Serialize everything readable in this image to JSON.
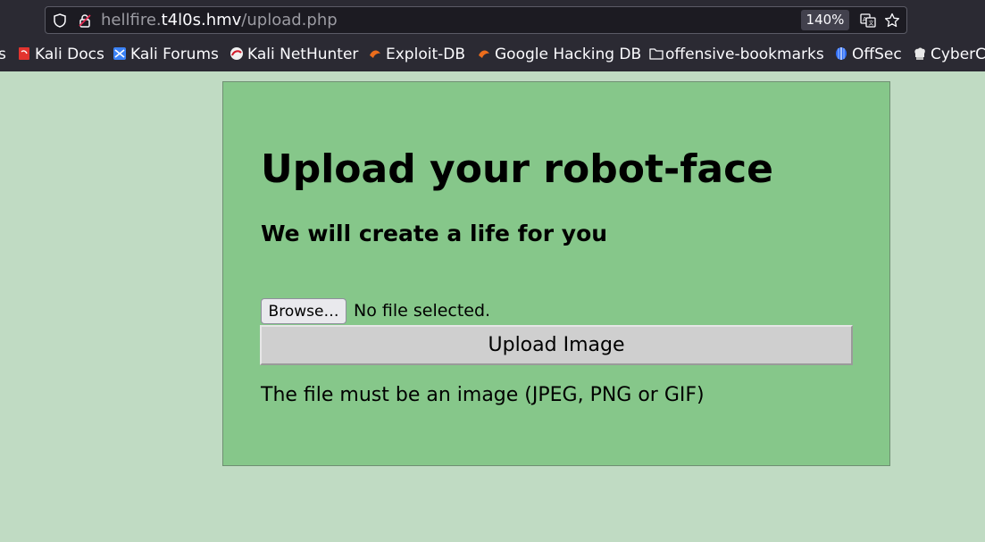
{
  "browser": {
    "url_prefix": "hellfire.",
    "url_host": "t4l0s.hmv",
    "url_path": "/upload.php",
    "zoom": "140%",
    "bookmarks": [
      {
        "label": "s",
        "icon": "truncated-bookmark"
      },
      {
        "label": "Kali Docs",
        "icon": "kali-docs-icon"
      },
      {
        "label": "Kali Forums",
        "icon": "kali-forums-icon"
      },
      {
        "label": "Kali NetHunter",
        "icon": "kali-nethunter-icon"
      },
      {
        "label": "Exploit-DB",
        "icon": "exploit-db-icon"
      },
      {
        "label": "Google Hacking DB",
        "icon": "google-hacking-db-icon"
      },
      {
        "label": "offensive-bookmarks",
        "icon": "folder-icon"
      },
      {
        "label": "OffSec",
        "icon": "offsec-icon"
      },
      {
        "label": "CyberC",
        "icon": "cyberchef-icon"
      }
    ]
  },
  "page": {
    "title": "Upload your robot-face",
    "subtitle": "We will create a life for you",
    "browse_label": "Browse…",
    "file_status": "No file selected.",
    "upload_label": "Upload Image",
    "note": "The file must be an image (JPEG, PNG or GIF)"
  },
  "colors": {
    "page_background": "#c0dbc3",
    "card_background": "#86c78a",
    "chrome_background": "#2b2a33"
  }
}
